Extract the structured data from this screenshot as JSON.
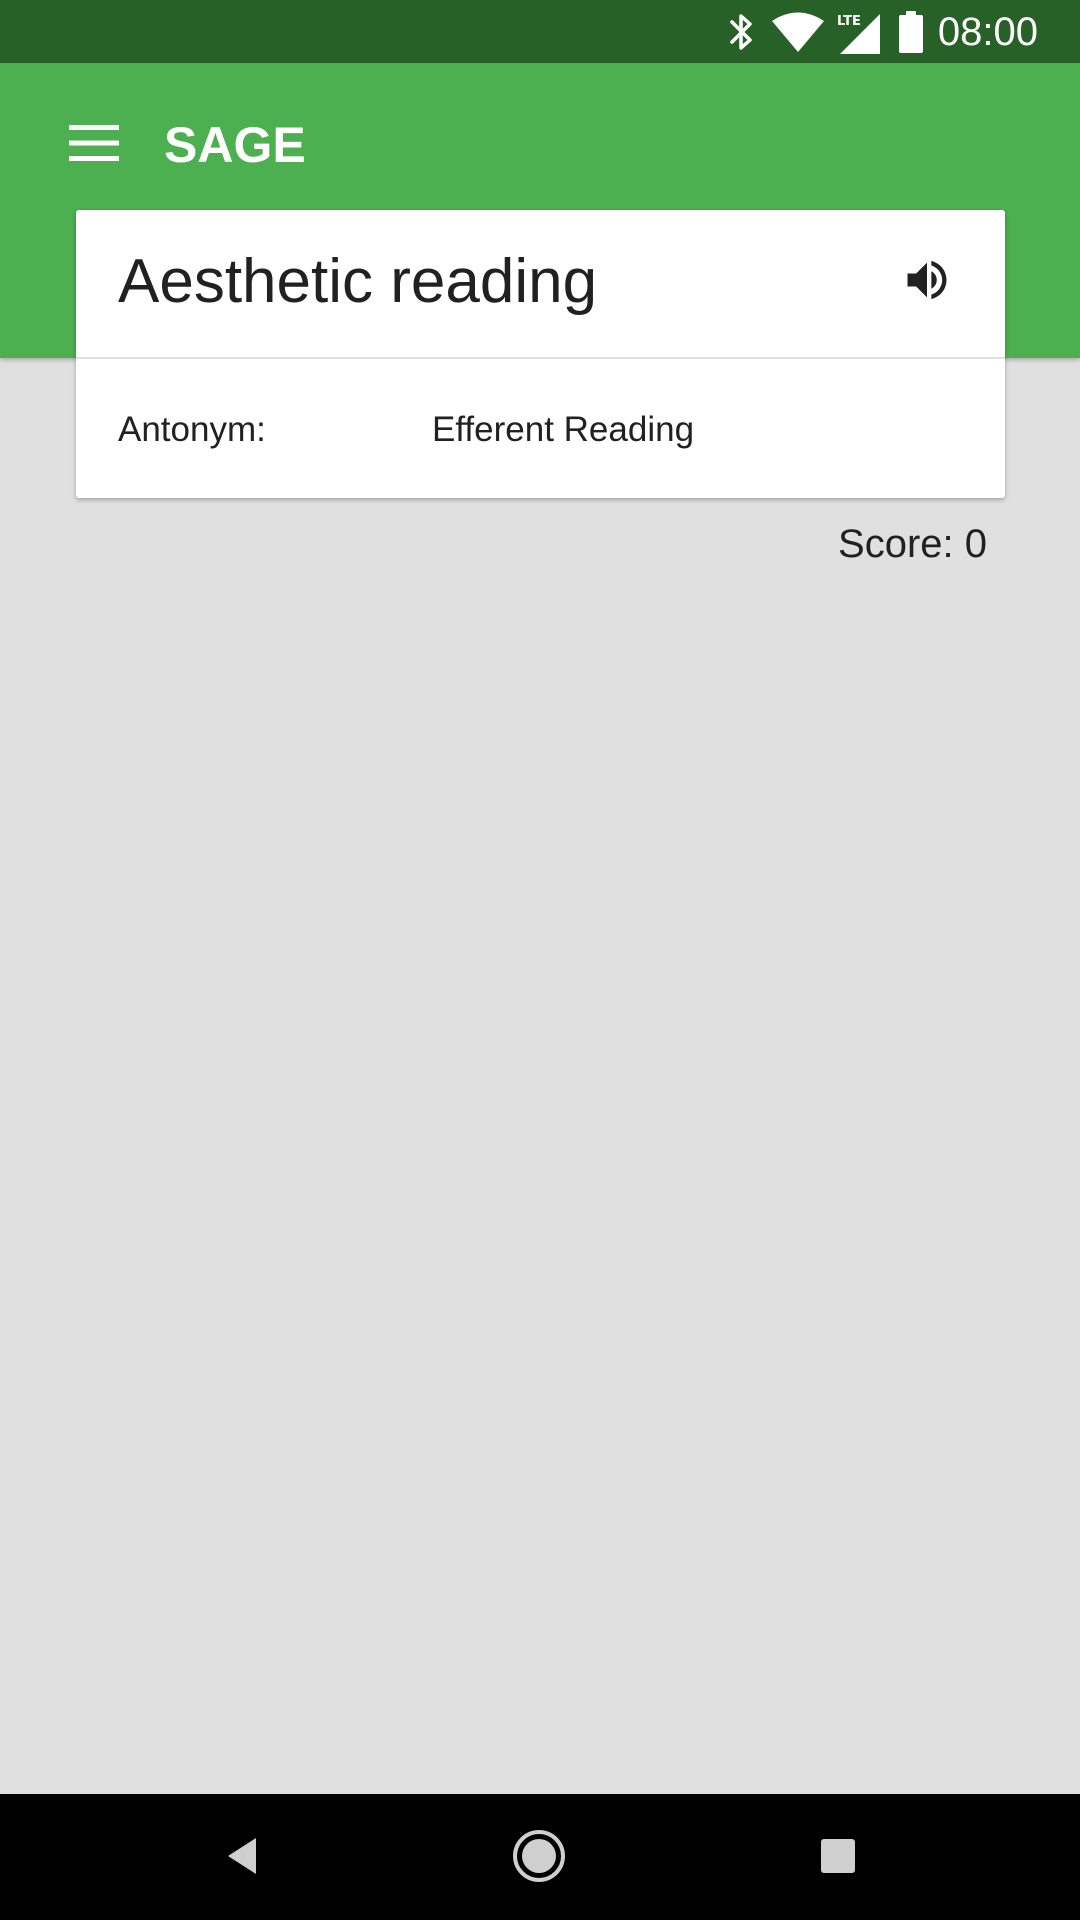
{
  "status_bar": {
    "time": "08:00",
    "icons": [
      "bluetooth-icon",
      "wifi-icon",
      "lte-signal-icon",
      "battery-icon"
    ],
    "lte_label": "LTE"
  },
  "app_bar": {
    "title": "SAGE",
    "menu_icon": "hamburger-menu-icon"
  },
  "card": {
    "term": "Aesthetic reading",
    "speaker_icon": "speaker-volume-icon",
    "relation_label": "Antonym:",
    "relation_value": "Efferent Reading"
  },
  "score": {
    "text": "Score: 0"
  },
  "nav_bar": {
    "icons": [
      "back-icon",
      "home-icon",
      "recents-icon"
    ]
  },
  "colors": {
    "status_bar": "#276127",
    "app_bar": "#4caf50",
    "background": "#e0e0e0",
    "card": "#ffffff",
    "text": "#212121",
    "nav_bar": "#000000"
  }
}
